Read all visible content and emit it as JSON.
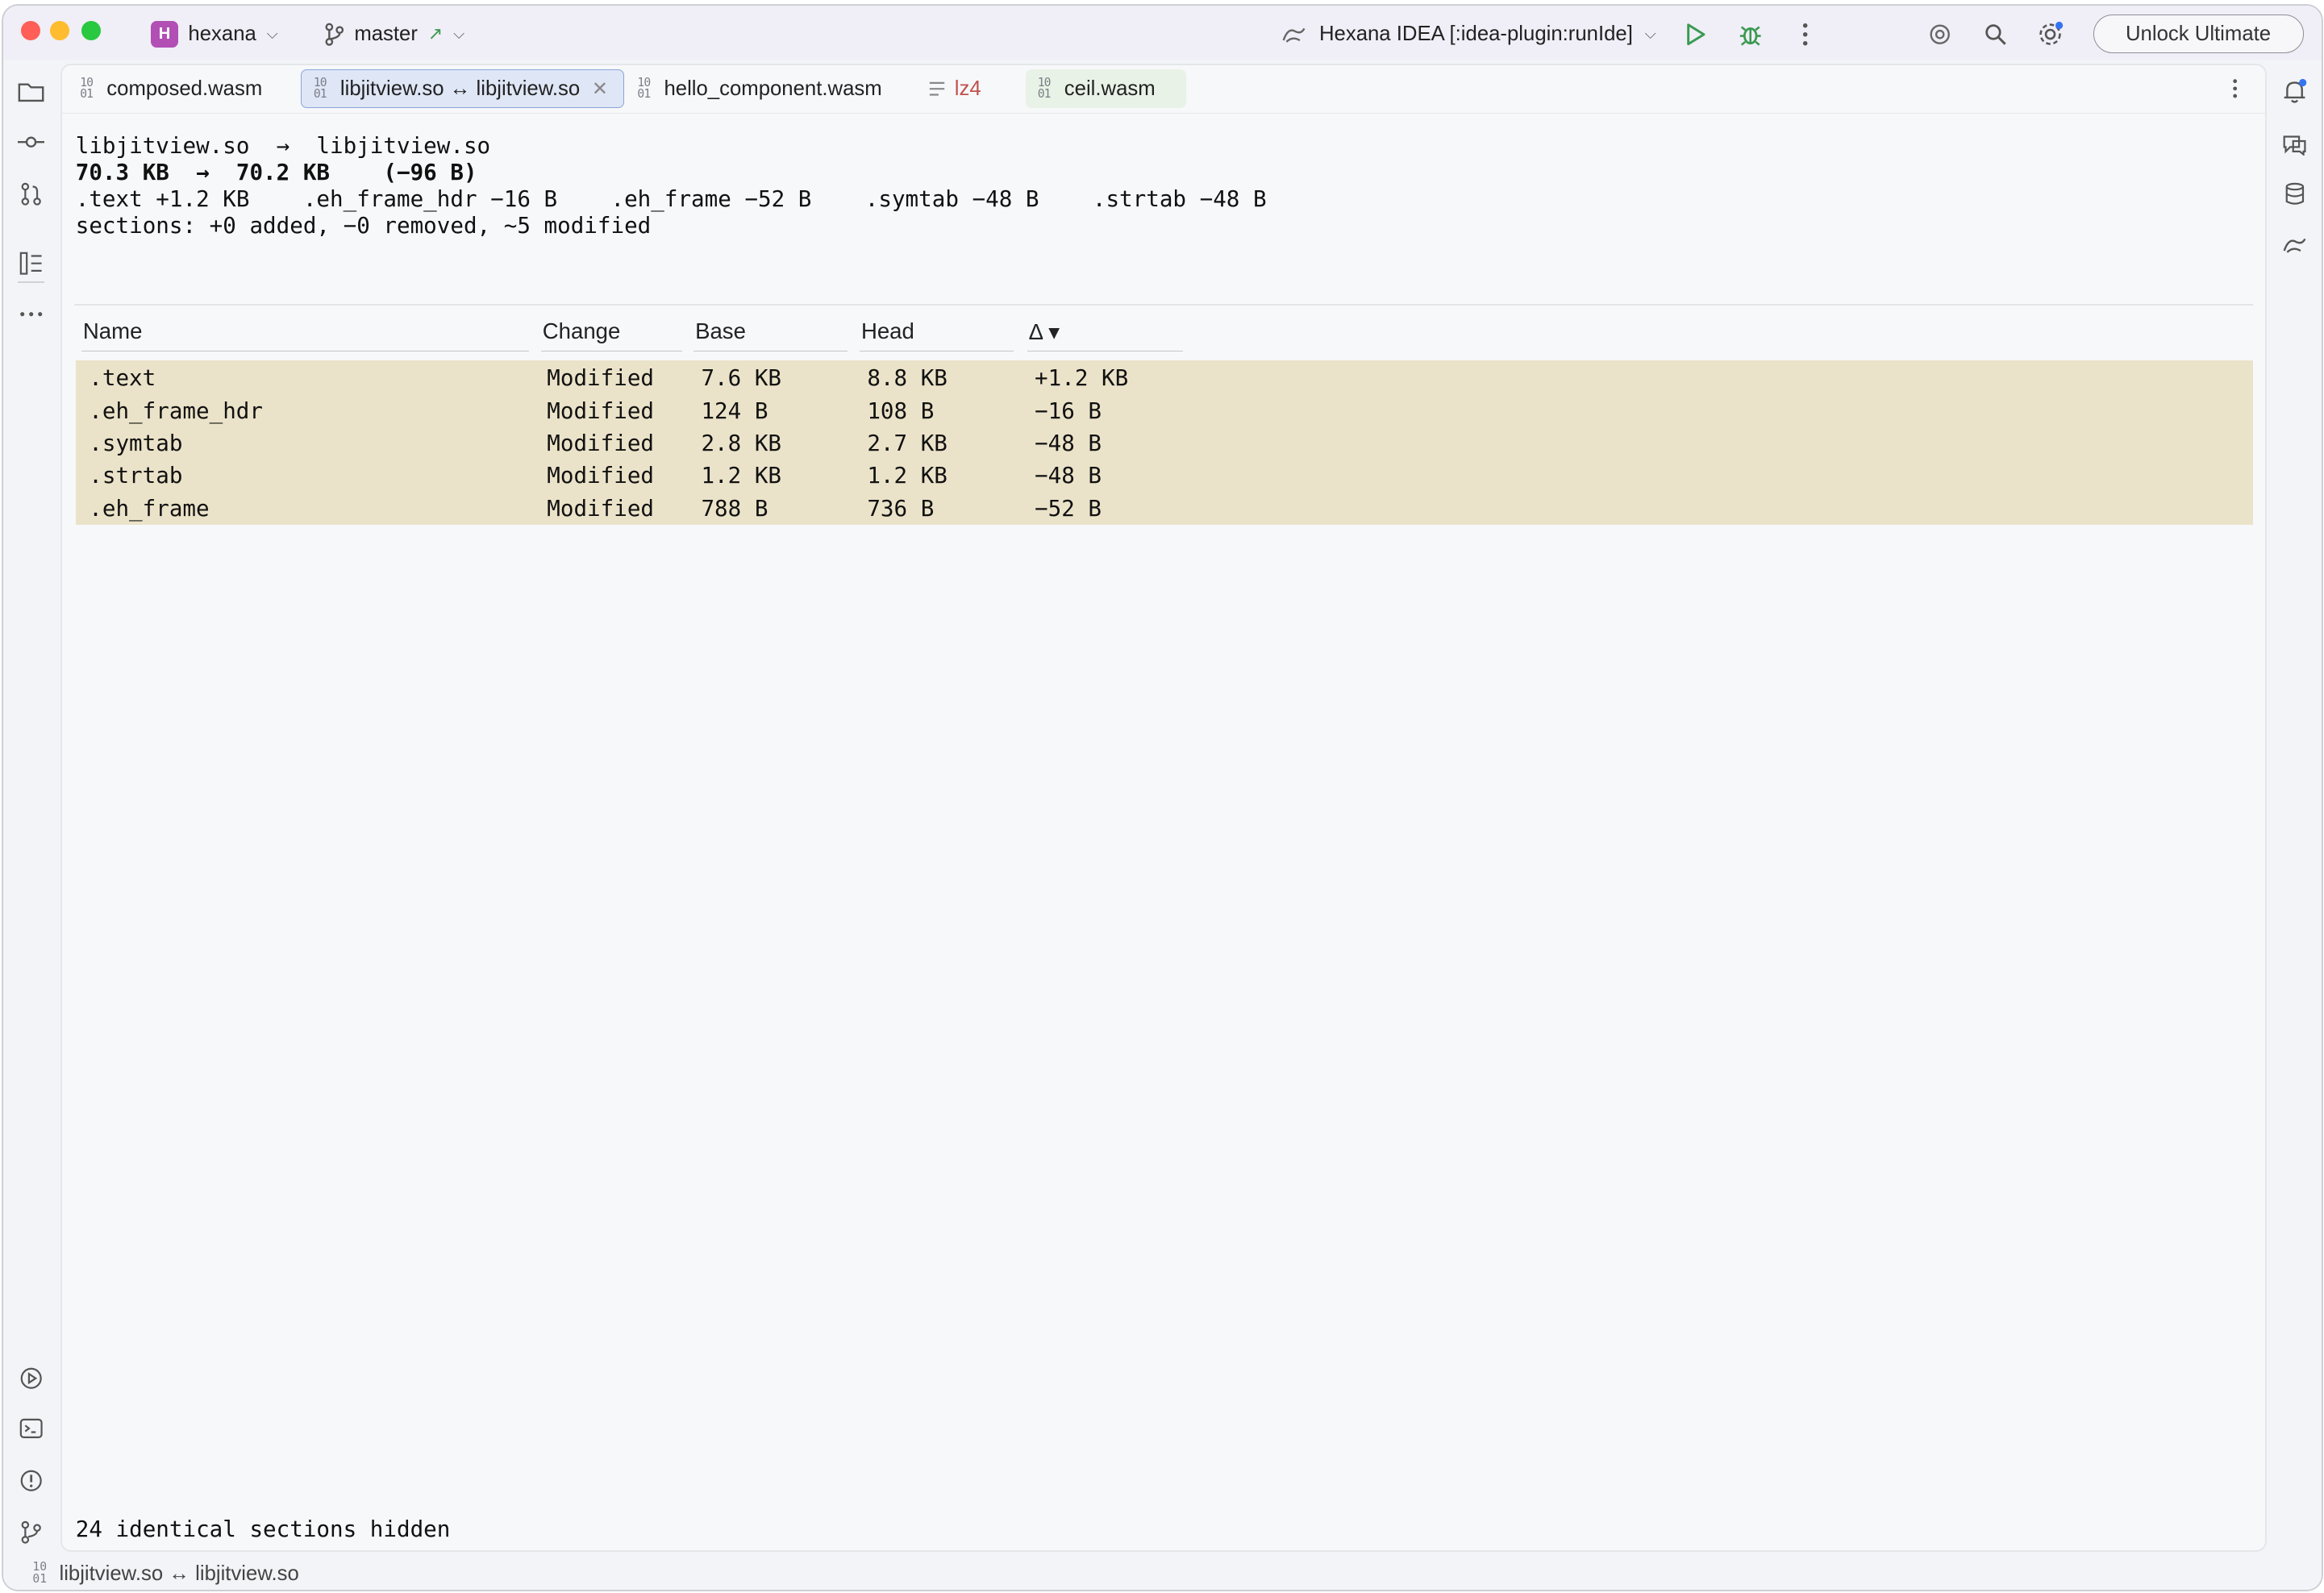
{
  "titlebar": {
    "project_badge": "H",
    "project_name": "hexana",
    "branch_name": "master",
    "run_config": "Hexana IDEA [:idea-plugin:runIde]",
    "unlock_label": "Unlock Ultimate"
  },
  "tabs": [
    {
      "label": "composed.wasm",
      "icon": "binary-file-icon"
    },
    {
      "label": "libjitview.so ↔ libjitview.so",
      "icon": "binary-file-icon",
      "active": true
    },
    {
      "label": "hello_component.wasm",
      "icon": "binary-file-icon"
    },
    {
      "label": "lz4",
      "icon": "text-file-icon"
    },
    {
      "label": "ceil.wasm",
      "icon": "binary-file-icon"
    }
  ],
  "summary": {
    "files_line": "libjitview.so  →  libjitview.so",
    "size_line": "70.3 KB  →  70.2 KB    (−96 B)",
    "deltas_line": ".text +1.2 KB    .eh_frame_hdr −16 B    .eh_frame −52 B    .symtab −48 B    .strtab −48 B",
    "sections_line": "sections: +0 added, −0 removed, ~5 modified"
  },
  "table": {
    "headers": {
      "name": "Name",
      "change": "Change",
      "base": "Base",
      "head": "Head",
      "delta": "Δ ▾"
    },
    "rows": [
      {
        "name": ".text",
        "change": "Modified",
        "base": "7.6 KB",
        "head": "8.8 KB",
        "delta": "+1.2 KB"
      },
      {
        "name": ".eh_frame_hdr",
        "change": "Modified",
        "base": "124 B",
        "head": "108 B",
        "delta": "−16 B"
      },
      {
        "name": ".symtab",
        "change": "Modified",
        "base": "2.8 KB",
        "head": "2.7 KB",
        "delta": "−48 B"
      },
      {
        "name": ".strtab",
        "change": "Modified",
        "base": "1.2 KB",
        "head": "1.2 KB",
        "delta": "−48 B"
      },
      {
        "name": ".eh_frame",
        "change": "Modified",
        "base": "788 B",
        "head": "736 B",
        "delta": "−52 B"
      }
    ]
  },
  "footer": {
    "hidden_text": "24 identical sections hidden"
  },
  "statusbar": {
    "path": "libjitview.so ↔ libjitview.so"
  },
  "colors": {
    "modified_row_bg": "#ebe3c9",
    "active_tab_bg": "#dfe6f6",
    "accent_run": "#3a9a52"
  }
}
